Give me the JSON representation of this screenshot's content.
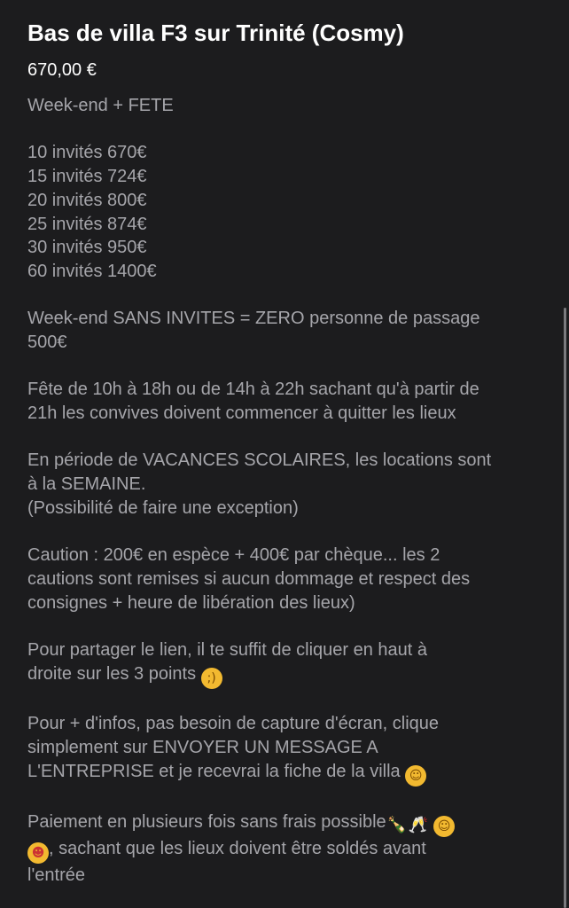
{
  "listing": {
    "title": "Bas de villa F3 sur Trinité (Cosmy)",
    "price": "670,00 €"
  },
  "description": {
    "p1": [
      "Week-end + FETE"
    ],
    "p2": [
      "10 invités 670€",
      "15 invités 724€",
      "20 invités 800€",
      "25 invités 874€",
      "30 invités 950€",
      "60 invités 1400€"
    ],
    "p3": [
      "Week-end SANS INVITES = ZERO personne de passage",
      "500€"
    ],
    "p4": [
      "Fête de 10h à 18h ou de 14h à 22h sachant qu'à partir de",
      "21h les convives doivent commencer à quitter les lieux"
    ],
    "p5": [
      "En période de VACANCES SCOLAIRES, les locations sont",
      "à la SEMAINE.",
      "(Possibilité de faire une exception)"
    ],
    "p6": [
      "Caution : 200€ en espèce + 400€ par chèque... les 2",
      "cautions sont remises si aucun dommage et respect des",
      "consignes + heure de libération des lieux)"
    ],
    "p7": [
      "Pour partager le lien, il te suffit de cliquer en haut à",
      "droite sur les 3 points"
    ],
    "p8": [
      "Pour + d'infos, pas besoin de capture d'écran, clique",
      "simplement sur ENVOYER UN MESSAGE A",
      "L'ENTREPRISE et je recevrai la fiche de la villa"
    ],
    "p9": [
      "Paiement en plusieurs fois sans frais possible",
      ", sachant que les lieux doivent être soldés avant",
      "l'entrée"
    ]
  },
  "icons": {
    "wink": "winking-face-icon",
    "hug": "hugging-face-icon",
    "bottle": "champagne-bottle-icon",
    "glasses": "clinking-glasses-icon",
    "party": "partying-face-icon"
  }
}
